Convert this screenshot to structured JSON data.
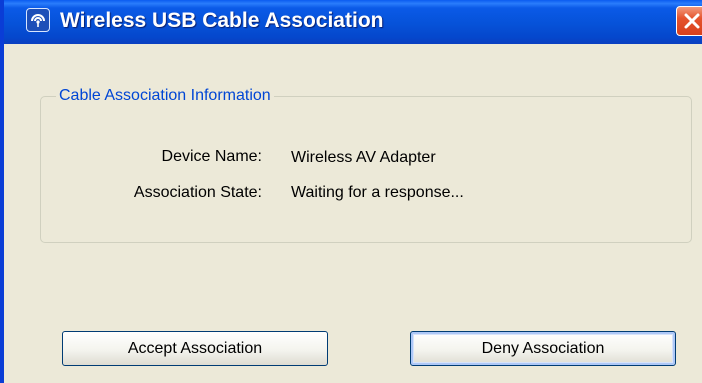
{
  "window": {
    "title": "Wireless USB Cable Association",
    "icon": "wireless-usb-icon"
  },
  "group": {
    "legend": "Cable Association Information",
    "rows": [
      {
        "label": "Device Name:",
        "value": "Wireless AV Adapter"
      },
      {
        "label": "Association State:",
        "value": "Waiting for a response..."
      }
    ]
  },
  "buttons": {
    "accept": "Accept Association",
    "deny": "Deny Association"
  },
  "colors": {
    "titlebar": "#0652d8",
    "close": "#e5542e",
    "legend": "#0046d5",
    "dialog_bg": "#ece9d8"
  }
}
